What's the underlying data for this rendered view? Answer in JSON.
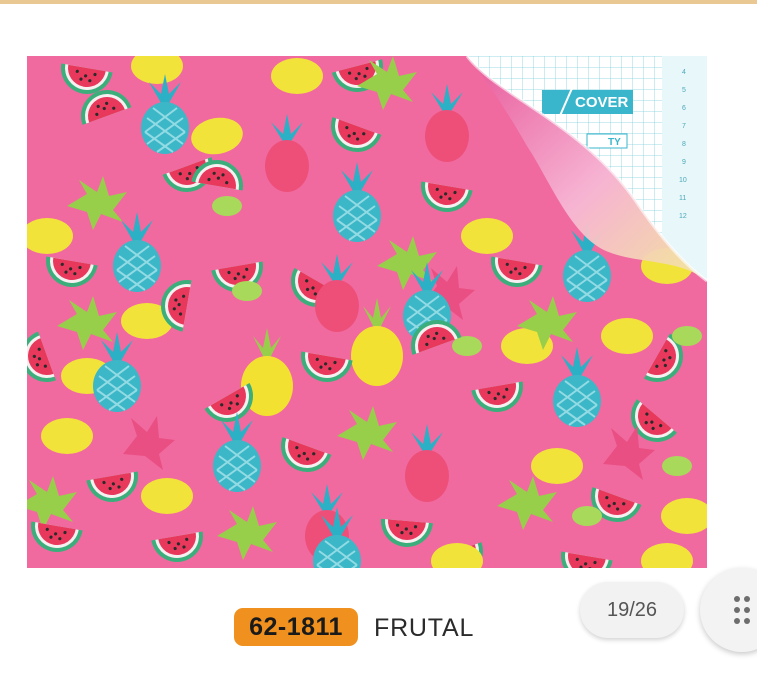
{
  "product": {
    "code": "62-1811",
    "name": "FRUTAL",
    "image": {
      "pattern_colors": {
        "background": "#f06aa0",
        "pineapple": "#f3e132",
        "lemon": "#f2e33a",
        "leaf": "#a9d85a",
        "teal": "#2fb4c8",
        "watermelon": "#e33c62"
      },
      "backing_brand": "COVER",
      "backing_partial_text": "TY",
      "ruler_numbers": [
        "4",
        "5",
        "6",
        "7",
        "8",
        "9",
        "10",
        "11",
        "12"
      ]
    }
  },
  "pager": {
    "label": "19/26",
    "current": 19,
    "total": 26
  },
  "menu_button": {
    "icon": "grid-dots-icon"
  },
  "colors": {
    "accent": "#f0901e",
    "top_rule": "#e9c893"
  }
}
